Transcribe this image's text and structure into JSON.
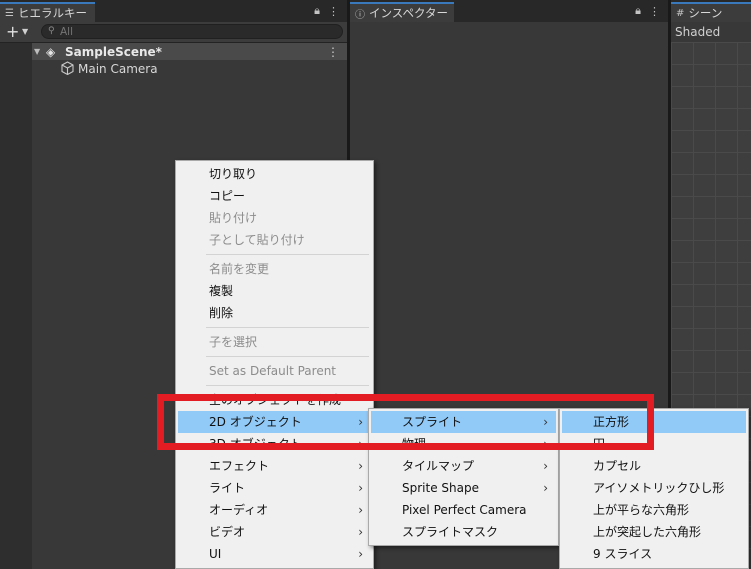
{
  "hierarchy": {
    "tab_title": "ヒエラルキー",
    "search_placeholder": "All",
    "scene_name": "SampleScene*",
    "objects": [
      "Main Camera"
    ]
  },
  "inspector": {
    "tab_title": "インスペクター"
  },
  "scene": {
    "tab_title": "シーン",
    "mode": "Shaded"
  },
  "context_menu": {
    "items": [
      "切り取り",
      "コピー",
      "貼り付け",
      "子として貼り付け",
      "名前を変更",
      "複製",
      "削除",
      "子を選択",
      "Set as Default Parent",
      "空のオブジェクトを作成",
      "2D オブジェクト",
      "3D オブジェクト",
      "エフェクト",
      "ライト",
      "オーディオ",
      "ビデオ",
      "UI"
    ]
  },
  "submenu_2d": {
    "items": [
      "スプライト",
      "物理",
      "タイルマップ",
      "Sprite Shape",
      "Pixel Perfect Camera",
      "スプライトマスク"
    ]
  },
  "submenu_sprite": {
    "items": [
      "正方形",
      "円",
      "カプセル",
      "アイソメトリックひし形",
      "上が平らな六角形",
      "上が突起した六角形",
      "9 スライス"
    ]
  },
  "colors": {
    "highlight": "#91c9f7",
    "annotation": "#e31c24",
    "tab_accent": "#3a79bb"
  }
}
